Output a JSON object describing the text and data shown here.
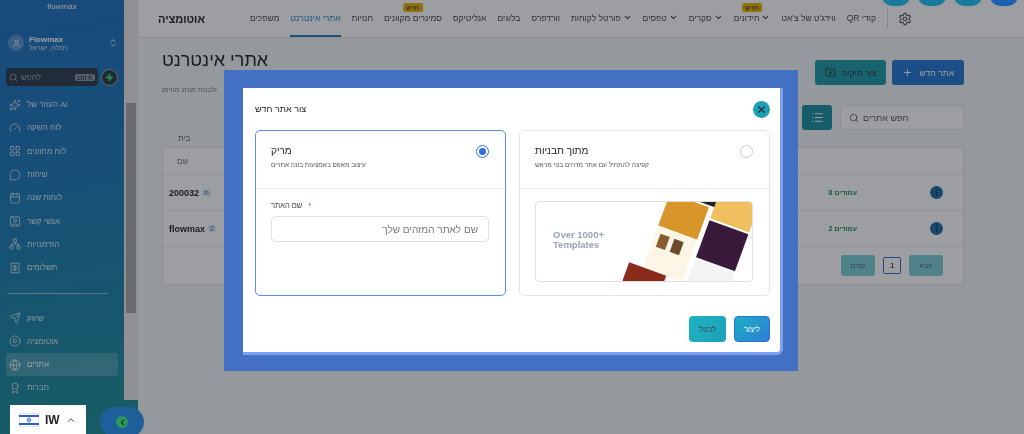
{
  "sidebar": {
    "logo": "flowmax",
    "account": {
      "name": "Flowmax",
      "location": "רמלה, ישראל"
    },
    "search": {
      "placeholder": "לחפש",
      "shortcut": "ctrl K"
    },
    "items": [
      {
        "label": "העוזר של AI",
        "selected": false
      },
      {
        "label": "לוח השקה",
        "selected": false
      },
      {
        "label": "לוח מחוונים",
        "selected": false
      },
      {
        "label": "שיחות",
        "selected": false
      },
      {
        "label": "לוחות שנה",
        "selected": false
      },
      {
        "label": "אנשי קשר",
        "selected": false
      },
      {
        "label": "הזדמנויות",
        "selected": false
      },
      {
        "label": "תשלומים",
        "selected": false
      }
    ],
    "items_2": [
      {
        "label": "שיווק",
        "selected": false
      },
      {
        "label": "אוטומציה",
        "selected": false
      },
      {
        "label": "אתרים",
        "selected": true
      },
      {
        "label": "חברות",
        "selected": false
      }
    ],
    "language": "IW"
  },
  "top_nav": {
    "items": [
      {
        "label": "QR קודי",
        "selected": false,
        "dropdown": false
      },
      {
        "label": "ווידג'ט של צ'אט",
        "selected": false,
        "dropdown": false
      },
      {
        "label": "חידונים",
        "selected": false,
        "dropdown": true,
        "badge": "חדש"
      },
      {
        "label": "סקרים",
        "selected": false,
        "dropdown": true
      },
      {
        "label": "טפסים",
        "selected": false,
        "dropdown": true
      },
      {
        "label": "פורטל לקוחות",
        "selected": false,
        "dropdown": true
      },
      {
        "label": "וורדפרס",
        "selected": false,
        "dropdown": false
      },
      {
        "label": "בלוגים",
        "selected": false,
        "dropdown": false
      },
      {
        "label": "אנליטיקס",
        "selected": false,
        "dropdown": false
      },
      {
        "label": "סמינרים מקוונים",
        "selected": false,
        "dropdown": false,
        "badge": "חדש"
      },
      {
        "label": "חנויות",
        "selected": false,
        "dropdown": false
      },
      {
        "label": "אתרי אינטרנט",
        "selected": true,
        "dropdown": false
      },
      {
        "label": "משפכים",
        "selected": false,
        "dropdown": false
      }
    ],
    "title": "אוטומציה"
  },
  "page": {
    "title": "אתרי אינטרנט",
    "subtitle": "ולבנות מותג מהימן",
    "buttons": [
      {
        "label": "אתר חדש",
        "kind": "new"
      },
      {
        "label": "צור תיקיה",
        "kind": "folder"
      }
    ],
    "search": {
      "placeholder": "חפש אתרים"
    },
    "breadcrumb": "בית",
    "table": {
      "columns": [
        "שם"
      ],
      "rows": [
        {
          "name": "200032",
          "tag": "ת",
          "pages": "עמודים 8"
        },
        {
          "name": "flowmax",
          "tag": "2",
          "pages": "עמודים 2"
        }
      ]
    },
    "pagination": {
      "next": "הבא",
      "page": "1",
      "previous": "קודם"
    }
  },
  "dialog": {
    "title": "צור אתר חדש",
    "options": [
      {
        "kind": "templates",
        "title": "מתוך תבניות",
        "description": "קפיצה להתחיל עם אתר מדהים בנוי מראש",
        "selected": false,
        "banner": "Over 1000+ Templates"
      },
      {
        "kind": "blank",
        "title": "מריק",
        "description": "עיצוב מאפס באמצעות בונה אתרים",
        "selected": true,
        "field": {
          "label": "שם האתר",
          "required_mark": "*",
          "placeholder": "שם לאתר המזהים שלך"
        }
      }
    ],
    "buttons": [
      {
        "label": "ליצור",
        "kind": "create"
      },
      {
        "label": "לבטל",
        "kind": "cancel"
      }
    ]
  }
}
